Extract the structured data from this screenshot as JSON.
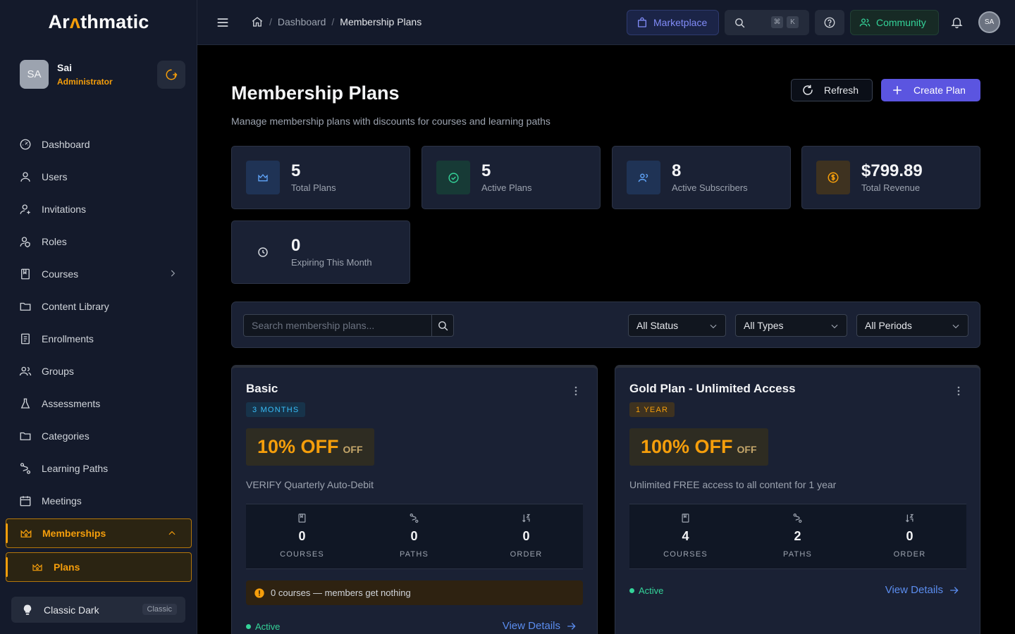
{
  "app": {
    "logo_pre": "Ar",
    "logo_acc": "ʌ",
    "logo_post": "thmatic"
  },
  "user": {
    "initials": "SA",
    "name": "Sai",
    "role": "Administrator"
  },
  "sidebar": {
    "items": [
      {
        "label": "Dashboard",
        "icon": "gauge-icon"
      },
      {
        "label": "Users",
        "icon": "user-icon"
      },
      {
        "label": "Invitations",
        "icon": "user-plus-icon"
      },
      {
        "label": "Roles",
        "icon": "user-shield-icon"
      },
      {
        "label": "Courses",
        "icon": "book-icon"
      },
      {
        "label": "Content Library",
        "icon": "folder-icon"
      },
      {
        "label": "Enrollments",
        "icon": "list-icon"
      },
      {
        "label": "Groups",
        "icon": "users-icon"
      },
      {
        "label": "Assessments",
        "icon": "flask-icon"
      },
      {
        "label": "Categories",
        "icon": "folder-icon"
      },
      {
        "label": "Learning Paths",
        "icon": "route-icon"
      },
      {
        "label": "Meetings",
        "icon": "calendar-icon"
      },
      {
        "label": "Memberships",
        "icon": "crown-icon"
      },
      {
        "label": "Plans",
        "icon": "crown-icon"
      }
    ],
    "theme": {
      "label": "Classic Dark",
      "badge": "Classic"
    }
  },
  "topbar": {
    "breadcrumb": [
      "Dashboard",
      "Membership Plans"
    ],
    "marketplace": "Marketplace",
    "shortcut": [
      "⌘",
      "K"
    ],
    "community": "Community",
    "avatar": "SA"
  },
  "page": {
    "title": "Membership Plans",
    "subtitle": "Manage membership plans with discounts for courses and learning paths",
    "refresh": "Refresh",
    "create": "Create Plan"
  },
  "stats": [
    {
      "value": "5",
      "label": "Total Plans"
    },
    {
      "value": "5",
      "label": "Active Plans"
    },
    {
      "value": "8",
      "label": "Active Subscribers"
    },
    {
      "value": "$799.89",
      "label": "Total Revenue"
    },
    {
      "value": "0",
      "label": "Expiring This Month"
    }
  ],
  "filters": {
    "search_placeholder": "Search membership plans...",
    "status": "All Status",
    "types": "All Types",
    "periods": "All Periods"
  },
  "colors": {
    "accent": "#f59e0b",
    "primary": "#5b55e0",
    "success": "#34d399",
    "link": "#5b8def"
  },
  "plans": [
    {
      "name": "Basic",
      "period": "3 MONTHS",
      "discount": "10% OFF",
      "off": "OFF",
      "description": "VERIFY Quarterly Auto-Debit",
      "metrics": [
        {
          "value": "0",
          "label": "COURSES"
        },
        {
          "value": "0",
          "label": "PATHS"
        },
        {
          "value": "0",
          "label": "ORDER"
        }
      ],
      "warning": "0 courses — members get nothing",
      "status": "Active",
      "link": "View Details"
    },
    {
      "name": "Gold Plan - Unlimited Access",
      "period": "1 YEAR",
      "discount": "100% OFF",
      "off": "OFF",
      "description": "Unlimited FREE access to all content for 1 year",
      "metrics": [
        {
          "value": "4",
          "label": "COURSES"
        },
        {
          "value": "2",
          "label": "PATHS"
        },
        {
          "value": "0",
          "label": "ORDER"
        }
      ],
      "status": "Active",
      "link": "View Details"
    }
  ]
}
